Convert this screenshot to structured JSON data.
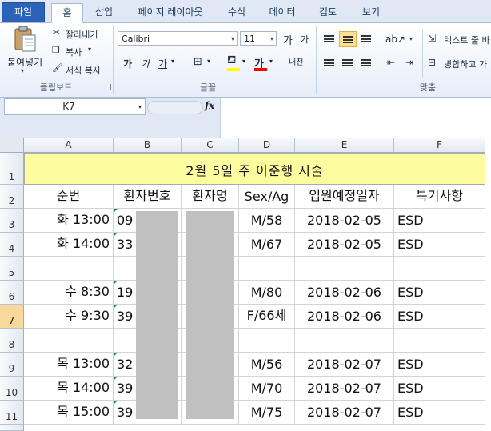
{
  "ribbon_tabs": [
    "파일",
    "홈",
    "삽입",
    "페이지 레이아웃",
    "수식",
    "데이터",
    "검토",
    "보기"
  ],
  "clipboard": {
    "paste_label": "붙여넣기",
    "cut_label": "잘라내기",
    "copy_label": "복사",
    "format_painter_label": "서식 복사",
    "group_label": "클립보드"
  },
  "font": {
    "font_name": "Calibri",
    "font_size": "11",
    "grow_label": "가",
    "shrink_label": "가",
    "bold_label": "가",
    "italic_label": "가",
    "underline_label": "가",
    "phonetic_label": "내천",
    "group_label": "글꼴",
    "fill_color": "#ffff00",
    "font_color": "#ff0000"
  },
  "alignment": {
    "wrap_text_label": "텍스트 줄 바",
    "merge_label": "병합하고 가",
    "group_label": "맞춤"
  },
  "formula_bar": {
    "name_box": "K7",
    "fx_label": "fx",
    "formula": ""
  },
  "columns": [
    "A",
    "B",
    "C",
    "D",
    "E",
    "F"
  ],
  "rows": [
    "1",
    "2",
    "3",
    "4",
    "5",
    "6",
    "7",
    "8",
    "9",
    "10",
    "11"
  ],
  "selected_row": "7",
  "sheet": {
    "title": "2월  5일  주  이준행  시술",
    "headers": [
      "순번",
      "환자번호",
      "환자명",
      "Sex/Ag",
      "입원예정일자",
      "특기사항"
    ],
    "records": [
      {
        "row": "3",
        "order": "화 13:00",
        "patient_no": "09",
        "sex_age": "M/58",
        "date": "2018-02-05",
        "note": "ESD"
      },
      {
        "row": "4",
        "order": "화 14:00",
        "patient_no": "33",
        "sex_age": "M/67",
        "date": "2018-02-05",
        "note": "ESD"
      },
      {
        "row": "6",
        "order": "수 8:30",
        "patient_no": "19",
        "sex_age": "M/80",
        "date": "2018-02-06",
        "note": "ESD"
      },
      {
        "row": "7",
        "order": "수 9:30",
        "patient_no": "39",
        "sex_age": "F/66세",
        "date": "2018-02-06",
        "note": "ESD"
      },
      {
        "row": "9",
        "order": "목 13:00",
        "patient_no": "32",
        "sex_age": "M/56",
        "date": "2018-02-07",
        "note": "ESD"
      },
      {
        "row": "10",
        "order": "목 14:00",
        "patient_no": "39",
        "sex_age": "M/70",
        "date": "2018-02-07",
        "note": "ESD"
      },
      {
        "row": "11",
        "order": "목 15:00",
        "patient_no": "39",
        "sex_age": "M/75",
        "date": "2018-02-07",
        "note": "ESD"
      }
    ]
  }
}
